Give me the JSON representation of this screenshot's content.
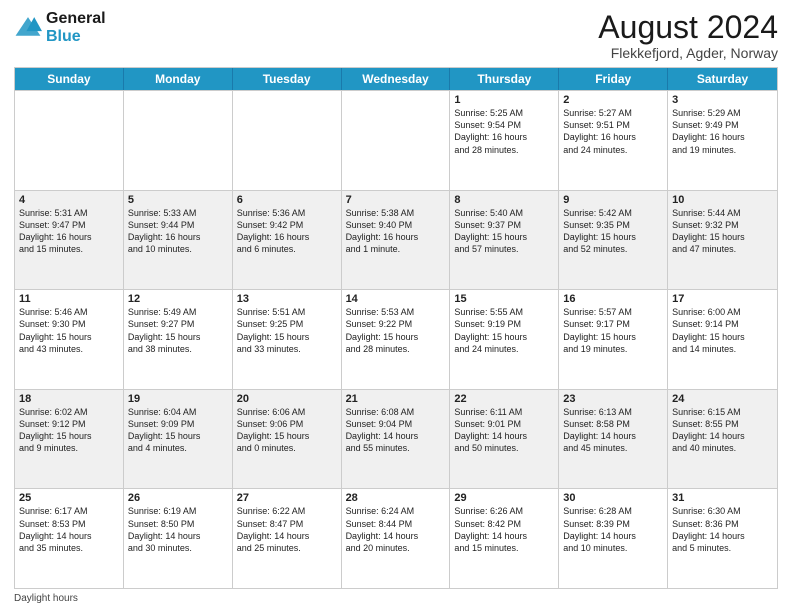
{
  "logo": {
    "line1": "General",
    "line2": "Blue"
  },
  "title": "August 2024",
  "subtitle": "Flekkefjord, Agder, Norway",
  "header": {
    "days": [
      "Sunday",
      "Monday",
      "Tuesday",
      "Wednesday",
      "Thursday",
      "Friday",
      "Saturday"
    ]
  },
  "footer": {
    "daylight_label": "Daylight hours"
  },
  "rows": [
    {
      "alt": false,
      "cells": [
        {
          "day": "",
          "text": ""
        },
        {
          "day": "",
          "text": ""
        },
        {
          "day": "",
          "text": ""
        },
        {
          "day": "",
          "text": ""
        },
        {
          "day": "1",
          "text": "Sunrise: 5:25 AM\nSunset: 9:54 PM\nDaylight: 16 hours\nand 28 minutes."
        },
        {
          "day": "2",
          "text": "Sunrise: 5:27 AM\nSunset: 9:51 PM\nDaylight: 16 hours\nand 24 minutes."
        },
        {
          "day": "3",
          "text": "Sunrise: 5:29 AM\nSunset: 9:49 PM\nDaylight: 16 hours\nand 19 minutes."
        }
      ]
    },
    {
      "alt": true,
      "cells": [
        {
          "day": "4",
          "text": "Sunrise: 5:31 AM\nSunset: 9:47 PM\nDaylight: 16 hours\nand 15 minutes."
        },
        {
          "day": "5",
          "text": "Sunrise: 5:33 AM\nSunset: 9:44 PM\nDaylight: 16 hours\nand 10 minutes."
        },
        {
          "day": "6",
          "text": "Sunrise: 5:36 AM\nSunset: 9:42 PM\nDaylight: 16 hours\nand 6 minutes."
        },
        {
          "day": "7",
          "text": "Sunrise: 5:38 AM\nSunset: 9:40 PM\nDaylight: 16 hours\nand 1 minute."
        },
        {
          "day": "8",
          "text": "Sunrise: 5:40 AM\nSunset: 9:37 PM\nDaylight: 15 hours\nand 57 minutes."
        },
        {
          "day": "9",
          "text": "Sunrise: 5:42 AM\nSunset: 9:35 PM\nDaylight: 15 hours\nand 52 minutes."
        },
        {
          "day": "10",
          "text": "Sunrise: 5:44 AM\nSunset: 9:32 PM\nDaylight: 15 hours\nand 47 minutes."
        }
      ]
    },
    {
      "alt": false,
      "cells": [
        {
          "day": "11",
          "text": "Sunrise: 5:46 AM\nSunset: 9:30 PM\nDaylight: 15 hours\nand 43 minutes."
        },
        {
          "day": "12",
          "text": "Sunrise: 5:49 AM\nSunset: 9:27 PM\nDaylight: 15 hours\nand 38 minutes."
        },
        {
          "day": "13",
          "text": "Sunrise: 5:51 AM\nSunset: 9:25 PM\nDaylight: 15 hours\nand 33 minutes."
        },
        {
          "day": "14",
          "text": "Sunrise: 5:53 AM\nSunset: 9:22 PM\nDaylight: 15 hours\nand 28 minutes."
        },
        {
          "day": "15",
          "text": "Sunrise: 5:55 AM\nSunset: 9:19 PM\nDaylight: 15 hours\nand 24 minutes."
        },
        {
          "day": "16",
          "text": "Sunrise: 5:57 AM\nSunset: 9:17 PM\nDaylight: 15 hours\nand 19 minutes."
        },
        {
          "day": "17",
          "text": "Sunrise: 6:00 AM\nSunset: 9:14 PM\nDaylight: 15 hours\nand 14 minutes."
        }
      ]
    },
    {
      "alt": true,
      "cells": [
        {
          "day": "18",
          "text": "Sunrise: 6:02 AM\nSunset: 9:12 PM\nDaylight: 15 hours\nand 9 minutes."
        },
        {
          "day": "19",
          "text": "Sunrise: 6:04 AM\nSunset: 9:09 PM\nDaylight: 15 hours\nand 4 minutes."
        },
        {
          "day": "20",
          "text": "Sunrise: 6:06 AM\nSunset: 9:06 PM\nDaylight: 15 hours\nand 0 minutes."
        },
        {
          "day": "21",
          "text": "Sunrise: 6:08 AM\nSunset: 9:04 PM\nDaylight: 14 hours\nand 55 minutes."
        },
        {
          "day": "22",
          "text": "Sunrise: 6:11 AM\nSunset: 9:01 PM\nDaylight: 14 hours\nand 50 minutes."
        },
        {
          "day": "23",
          "text": "Sunrise: 6:13 AM\nSunset: 8:58 PM\nDaylight: 14 hours\nand 45 minutes."
        },
        {
          "day": "24",
          "text": "Sunrise: 6:15 AM\nSunset: 8:55 PM\nDaylight: 14 hours\nand 40 minutes."
        }
      ]
    },
    {
      "alt": false,
      "cells": [
        {
          "day": "25",
          "text": "Sunrise: 6:17 AM\nSunset: 8:53 PM\nDaylight: 14 hours\nand 35 minutes."
        },
        {
          "day": "26",
          "text": "Sunrise: 6:19 AM\nSunset: 8:50 PM\nDaylight: 14 hours\nand 30 minutes."
        },
        {
          "day": "27",
          "text": "Sunrise: 6:22 AM\nSunset: 8:47 PM\nDaylight: 14 hours\nand 25 minutes."
        },
        {
          "day": "28",
          "text": "Sunrise: 6:24 AM\nSunset: 8:44 PM\nDaylight: 14 hours\nand 20 minutes."
        },
        {
          "day": "29",
          "text": "Sunrise: 6:26 AM\nSunset: 8:42 PM\nDaylight: 14 hours\nand 15 minutes."
        },
        {
          "day": "30",
          "text": "Sunrise: 6:28 AM\nSunset: 8:39 PM\nDaylight: 14 hours\nand 10 minutes."
        },
        {
          "day": "31",
          "text": "Sunrise: 6:30 AM\nSunset: 8:36 PM\nDaylight: 14 hours\nand 5 minutes."
        }
      ]
    }
  ]
}
